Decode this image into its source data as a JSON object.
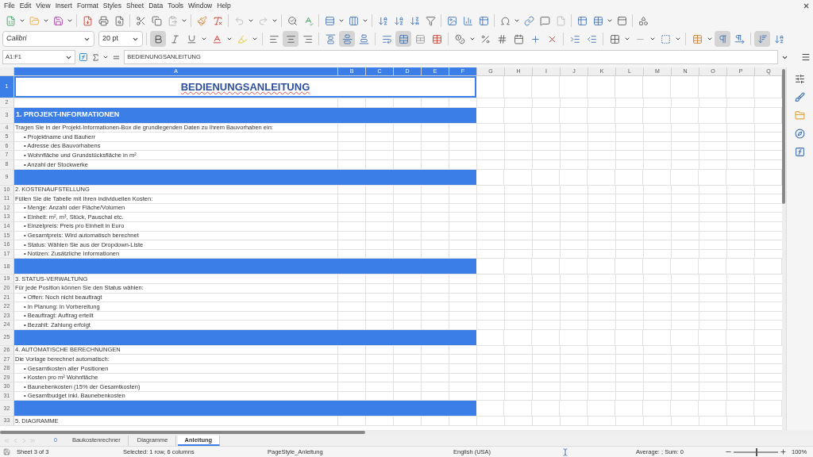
{
  "menu": [
    "File",
    "Edit",
    "View",
    "Insert",
    "Format",
    "Styles",
    "Sheet",
    "Data",
    "Tools",
    "Window",
    "Help"
  ],
  "format": {
    "font_name": "Calibri",
    "font_size": "20 pt",
    "bold": true,
    "italic": false,
    "underline": false,
    "align_left": false,
    "align_center": true,
    "align_right": false,
    "align_top": false,
    "align_middle": true,
    "align_bottom": false,
    "merged": true,
    "text_direction_ltr": true,
    "wrap_text": true
  },
  "formula_bar": {
    "name_box": "A1:F1",
    "content": "BEDIENUNGSANLEITUNG"
  },
  "grid": {
    "columns": [
      {
        "label": "A",
        "selected": true
      },
      {
        "label": "B",
        "selected": true
      },
      {
        "label": "C",
        "selected": true
      },
      {
        "label": "D",
        "selected": true
      },
      {
        "label": "E",
        "selected": true
      },
      {
        "label": "F",
        "selected": true
      },
      {
        "label": "G",
        "selected": false
      },
      {
        "label": "H",
        "selected": false
      },
      {
        "label": "I",
        "selected": false
      },
      {
        "label": "J",
        "selected": false
      },
      {
        "label": "K",
        "selected": false
      },
      {
        "label": "L",
        "selected": false
      },
      {
        "label": "M",
        "selected": false
      },
      {
        "label": "N",
        "selected": false
      },
      {
        "label": "O",
        "selected": false
      },
      {
        "label": "P",
        "selected": false
      },
      {
        "label": "Q",
        "selected": false
      }
    ],
    "rows": [
      {
        "number": "1",
        "selected": true,
        "kind": "title",
        "text": "BEDIENUNGSANLEITUNG"
      },
      {
        "number": "2",
        "selected": false,
        "kind": "empty"
      },
      {
        "number": "3",
        "selected": false,
        "kind": "section",
        "text": "1. PROJEKT-INFORMATIONEN"
      },
      {
        "number": "4",
        "selected": false,
        "kind": "text",
        "text": "Tragen Sie in der Projekt-Informationen-Box die grundlegenden Daten zu Ihrem Bauvorhaben ein:"
      },
      {
        "number": "5",
        "selected": false,
        "kind": "bullet",
        "text": "• Projektname und Bauherr"
      },
      {
        "number": "6",
        "selected": false,
        "kind": "bullet",
        "text": "• Adresse des Bauvorhabens"
      },
      {
        "number": "7",
        "selected": false,
        "kind": "bullet",
        "text": "• Wohnfläche und Grundstücksfläche in m²"
      },
      {
        "number": "8",
        "selected": false,
        "kind": "bullet",
        "text": "• Anzahl der Stockwerke"
      },
      {
        "number": "9",
        "selected": false,
        "kind": "band"
      },
      {
        "number": "10",
        "selected": false,
        "kind": "text",
        "text": "2. KOSTENAUFSTELLUNG"
      },
      {
        "number": "11",
        "selected": false,
        "kind": "text",
        "text": "Füllen Sie die Tabelle mit Ihren individuellen Kosten:"
      },
      {
        "number": "12",
        "selected": false,
        "kind": "bullet",
        "text": "• Menge: Anzahl oder Fläche/Volumen"
      },
      {
        "number": "13",
        "selected": false,
        "kind": "bullet",
        "text": "• Einheit: m², m³, Stück, Pauschal etc."
      },
      {
        "number": "14",
        "selected": false,
        "kind": "bullet",
        "text": "• Einzelpreis: Preis pro Einheit in Euro"
      },
      {
        "number": "15",
        "selected": false,
        "kind": "bullet",
        "text": "• Gesamtpreis: Wird automatisch berechnet"
      },
      {
        "number": "16",
        "selected": false,
        "kind": "bullet",
        "text": "• Status: Wählen Sie aus der Dropdown-Liste"
      },
      {
        "number": "17",
        "selected": false,
        "kind": "bullet",
        "text": "• Notizen: Zusätzliche Informationen"
      },
      {
        "number": "18",
        "selected": false,
        "kind": "band"
      },
      {
        "number": "19",
        "selected": false,
        "kind": "text",
        "text": "3. STATUS-VERWALTUNG"
      },
      {
        "number": "20",
        "selected": false,
        "kind": "text",
        "text": "Für jede Position können Sie den Status wählen:"
      },
      {
        "number": "21",
        "selected": false,
        "kind": "bullet",
        "text": "• Offen: Noch nicht beauftragt"
      },
      {
        "number": "22",
        "selected": false,
        "kind": "bullet",
        "text": "• In Planung: In Vorbereitung"
      },
      {
        "number": "23",
        "selected": false,
        "kind": "bullet",
        "text": "• Beauftragt: Auftrag erteilt"
      },
      {
        "number": "24",
        "selected": false,
        "kind": "bullet",
        "text": "• Bezahlt: Zahlung erfolgt"
      },
      {
        "number": "25",
        "selected": false,
        "kind": "band"
      },
      {
        "number": "26",
        "selected": false,
        "kind": "text",
        "text": "4. AUTOMATISCHE BERECHNUNGEN"
      },
      {
        "number": "27",
        "selected": false,
        "kind": "text",
        "text": "Die Vorlage berechnet automatisch:"
      },
      {
        "number": "28",
        "selected": false,
        "kind": "bullet",
        "text": "• Gesamtkosten aller Positionen"
      },
      {
        "number": "29",
        "selected": false,
        "kind": "bullet",
        "text": "• Kosten pro m² Wohnfläche"
      },
      {
        "number": "30",
        "selected": false,
        "kind": "bullet",
        "text": "• Baunebenkosten (15% der Gesamtkosten)"
      },
      {
        "number": "31",
        "selected": false,
        "kind": "bullet",
        "text": "• Gesamtbudget inkl. Baunebenkosten"
      },
      {
        "number": "32",
        "selected": false,
        "kind": "band"
      },
      {
        "number": "33",
        "selected": false,
        "kind": "text",
        "text": "5. DIAGRAMME"
      }
    ]
  },
  "sheet_tabs": {
    "count": "0",
    "tabs": [
      {
        "label": "Baukostenrechner",
        "selected": false
      },
      {
        "label": "Diagramme",
        "selected": false
      },
      {
        "label": "Anleitung",
        "selected": true
      }
    ]
  },
  "status_bar": {
    "sheet": "Sheet 3 of 3",
    "selection": "Selected: 1 row, 6 columns",
    "page_style": "PageStyle_Anleitung",
    "language": "English (USA)",
    "summary": "Average: ; Sum: 0",
    "zoom": {
      "level": 0.5,
      "reading": "100%"
    }
  }
}
